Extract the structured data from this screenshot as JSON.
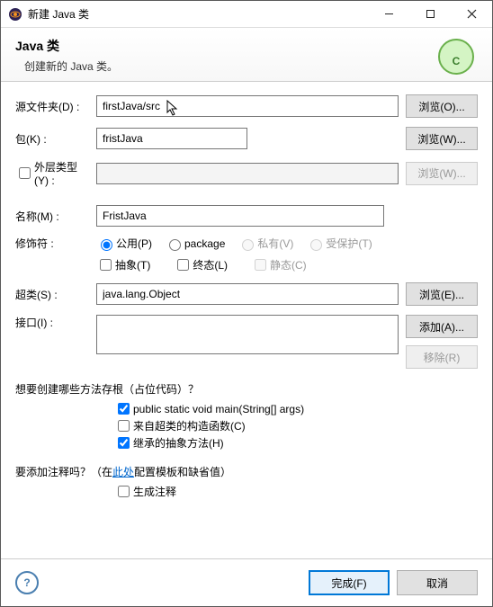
{
  "window": {
    "title": "新建 Java 类"
  },
  "header": {
    "title": "Java 类",
    "subtitle": "创建新的 Java 类。"
  },
  "labels": {
    "sourceFolder": "源文件夹(D) :",
    "package": "包(K) :",
    "enclosingType": "外层类型(Y) :",
    "name": "名称(M) :",
    "modifiers": "修饰符 :",
    "superclass": "超类(S) :",
    "interfaces": "接口(I) :"
  },
  "fields": {
    "sourceFolder": "firstJava/src",
    "package": "fristJava",
    "enclosingType": "",
    "name": "FristJava",
    "superclass": "java.lang.Object"
  },
  "buttons": {
    "browseO": "浏览(O)...",
    "browseW": "浏览(W)...",
    "browseW2": "浏览(W)...",
    "browseE": "浏览(E)...",
    "addA": "添加(A)...",
    "removeR": "移除(R)",
    "finish": "完成(F)",
    "cancel": "取消"
  },
  "modifiers": {
    "public": "公用(P)",
    "package": "package",
    "private": "私有(V)",
    "protected": "受保护(T)",
    "abstract": "抽象(T)",
    "final": "终态(L)",
    "static": "静态(C)"
  },
  "stubs": {
    "question": "想要创建哪些方法存根（占位代码）？",
    "main": "public static void main(String[] args)",
    "superConstructors": "来自超类的构造函数(C)",
    "inheritedAbstract": "继承的抽象方法(H)"
  },
  "comments": {
    "question_prefix": "要添加注释吗？（在",
    "link": "此处",
    "question_suffix": "配置模板和缺省值）",
    "generate": "生成注释"
  },
  "state": {
    "enclosingChecked": false,
    "modifierRadio": "public",
    "abstractChecked": false,
    "finalChecked": false,
    "staticChecked": false,
    "mainChecked": true,
    "superConstructorsChecked": false,
    "inheritedAbstractChecked": true,
    "generateCommentsChecked": false
  }
}
